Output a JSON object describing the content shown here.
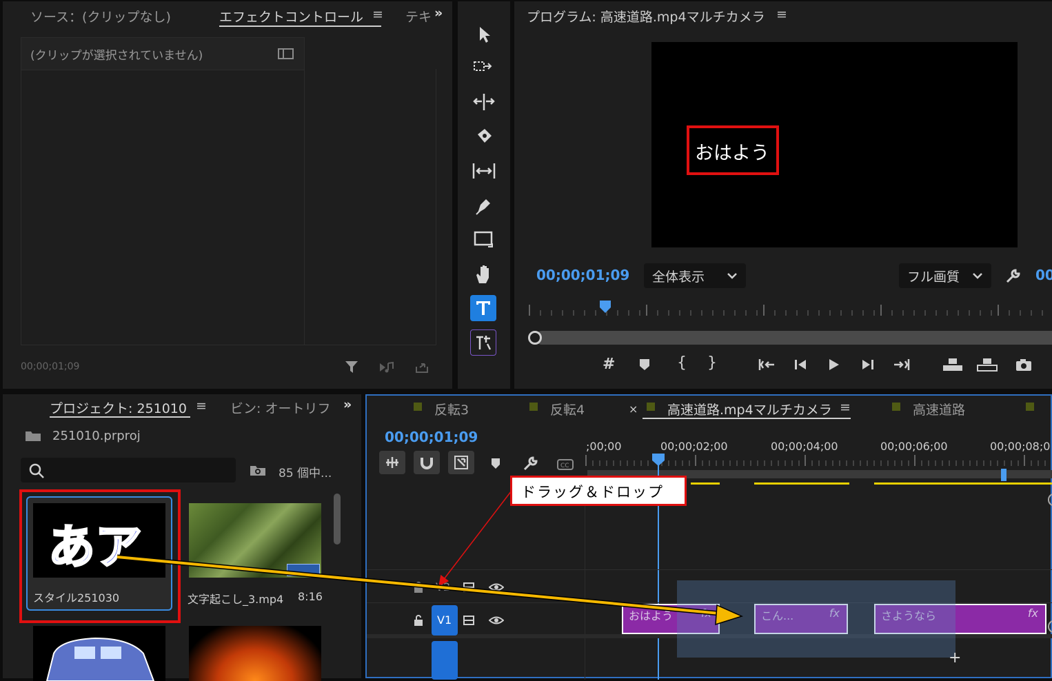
{
  "source_panel": {
    "tab_source": "ソース：(クリップなし)",
    "tab_effect": "エフェクトコントロール",
    "tab_text": "テキ",
    "no_clip": "(クリップが選択されていません)",
    "timecode": "00;00;01;09"
  },
  "program_panel": {
    "title": "プログラム: 高速道路.mp4マルチカメラ",
    "overlay_text": "おはよう",
    "timecode": "00;00;01;09",
    "fit_dropdown": "全体表示",
    "quality_dropdown": "フル画質",
    "end_timecode_partial": "00"
  },
  "project_panel": {
    "tab_project": "プロジェクト: 251010",
    "tab_bin": "ビン: オートリフ",
    "file": "251010.prproj",
    "search_placeholder": "",
    "item_count": "85 個中...",
    "items": [
      {
        "thumb": "あア",
        "name": "スタイル251030",
        "duration": ""
      },
      {
        "thumb": "",
        "name": "文字起こし_3.mp4",
        "duration": "8:16"
      }
    ]
  },
  "timeline": {
    "tabs": [
      "反転3",
      "反転4",
      "高速道路.mp4マルチカメラ",
      "高速道路"
    ],
    "close_mark": "×",
    "timecode": "00;00;01;09",
    "ruler": [
      ";00;00",
      "00;00;02;00",
      "00;00;04;00",
      "00;00;06;00",
      "00;00;08;0"
    ],
    "tracks": [
      "V2",
      "V1"
    ],
    "clips": [
      {
        "label": "おはよう",
        "fx": "fx"
      },
      {
        "label": "こん...",
        "fx": "fx"
      },
      {
        "label": "さようなら",
        "fx": "fx"
      }
    ]
  },
  "callout": {
    "text": "ドラッグ＆ドロップ"
  },
  "colors": {
    "accent_blue": "#4a9cf0",
    "highlight_red": "#e01010",
    "arrow_yellow": "#f5b800",
    "clip_purple": "#8b2aa6"
  }
}
